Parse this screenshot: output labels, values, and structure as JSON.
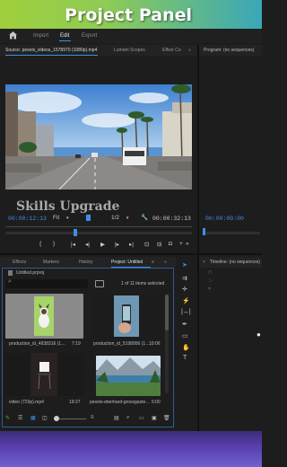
{
  "banner": {
    "title": "Project Panel"
  },
  "menu": {
    "home_icon": "home-icon",
    "items": [
      "Import",
      "Edit",
      "Export"
    ],
    "active": "Edit"
  },
  "source_panel": {
    "tab_title": "Source: pexels_videos_1578970 (1080p).mp4",
    "tab_lumetri": "Lumetri Scopes",
    "tab_effect": "Effect Co",
    "more": "»",
    "timecode_current": "00:00:12:13",
    "fit": "Fit",
    "resolution": "1/2",
    "timecode_duration": "00:00:32:13",
    "watermark": "Skills Upgrade"
  },
  "program_panel": {
    "tab_title": "Program: (no sequences)",
    "timecode": "00:00:00:00"
  },
  "project_panel": {
    "tabs": [
      "Effects",
      "Markers",
      "History",
      "Project: Untitled"
    ],
    "active_tab": "Project: Untitled",
    "file_name": "Untitled.prproj",
    "items_selected": "1 of 11 items selected",
    "items": [
      {
        "name": "production_id_4838316 (1…",
        "duration": "7:19"
      },
      {
        "name": "production_id_5198956 (1…",
        "duration": "10:06"
      },
      {
        "name": "video (720p).mp4",
        "duration": "19:27"
      },
      {
        "name": "pexels-eberhard-grossgaste…",
        "duration": "5:00"
      }
    ]
  },
  "timeline_panel": {
    "tab_title": "Timeline: (no sequences)"
  },
  "colors": {
    "accent": "#3f8de8",
    "banner_start": "#9fcf3c",
    "banner_end": "#3aa7b8",
    "panel_bg": "#1d1d1d"
  }
}
